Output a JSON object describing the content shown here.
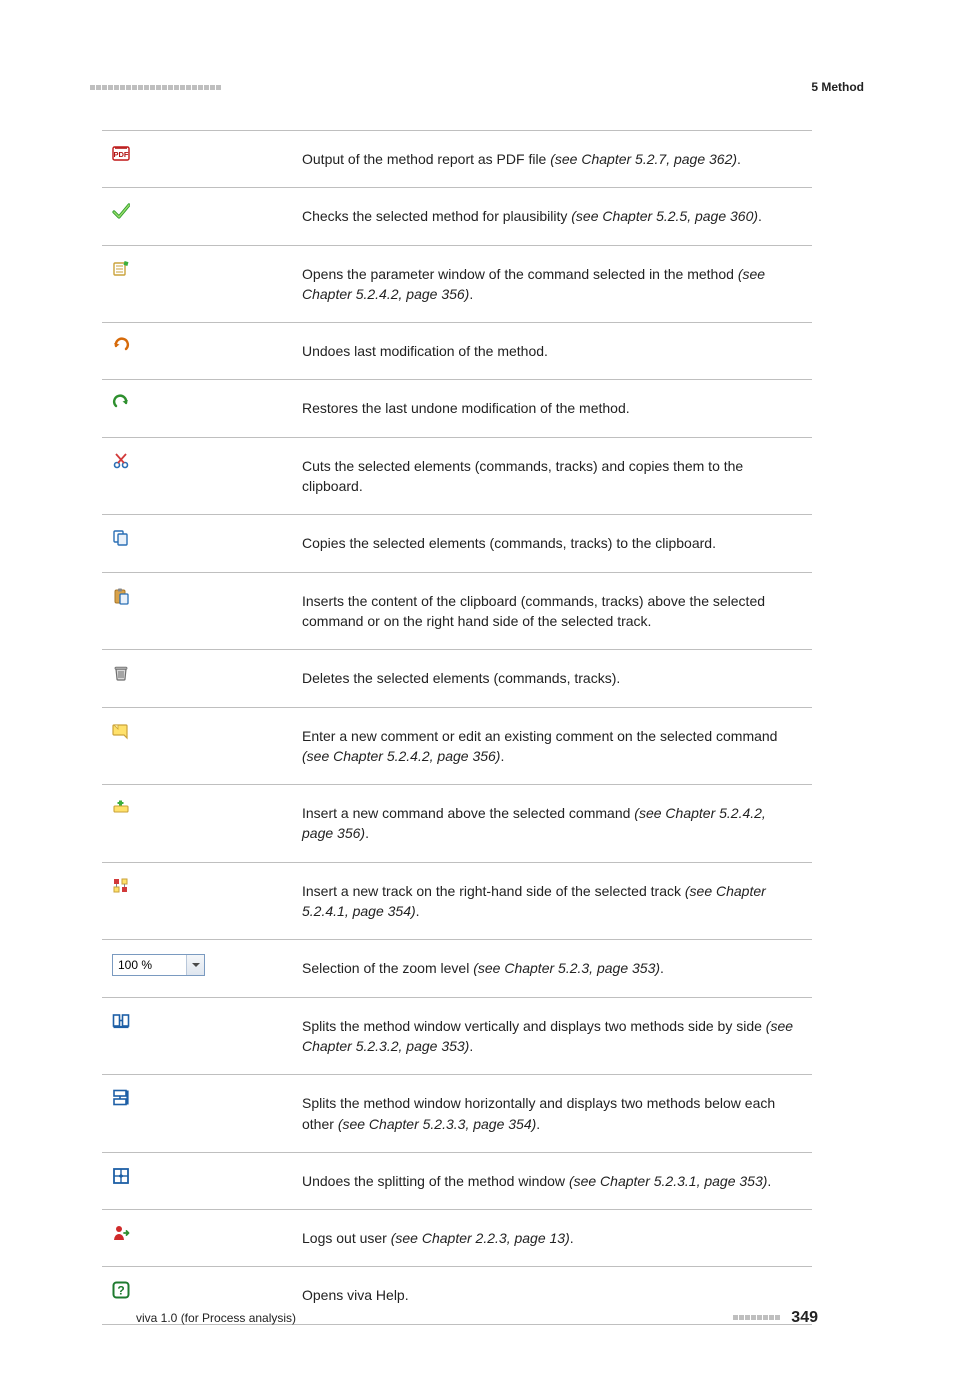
{
  "header": {
    "chapter": "5 Method"
  },
  "rows": [
    {
      "icon": "pdf",
      "desc": "Output of the method report as PDF file ",
      "ital": "(see Chapter 5.2.7, page 362)",
      "tail": "."
    },
    {
      "icon": "check",
      "desc": "Checks the selected method for plausibility ",
      "ital": "(see Chapter 5.2.5, page 360)",
      "tail": "."
    },
    {
      "icon": "properties",
      "desc": "Opens the parameter window of the command selected in the method ",
      "ital": "(see Chapter 5.2.4.2, page 356)",
      "tail": "."
    },
    {
      "icon": "undo",
      "desc": "Undoes last modification of the method.",
      "ital": "",
      "tail": ""
    },
    {
      "icon": "redo",
      "desc": "Restores the last undone modification of the method.",
      "ital": "",
      "tail": ""
    },
    {
      "icon": "cut",
      "desc": "Cuts the selected elements (commands, tracks) and copies them to the clipboard.",
      "ital": "",
      "tail": ""
    },
    {
      "icon": "copy",
      "desc": "Copies the selected elements (commands, tracks) to the clipboard.",
      "ital": "",
      "tail": ""
    },
    {
      "icon": "paste",
      "desc": "Inserts the content of the clipboard (commands, tracks) above the selected command or on the right hand side of the selected track.",
      "ital": "",
      "tail": ""
    },
    {
      "icon": "delete",
      "desc": "Deletes the selected elements (commands, tracks).",
      "ital": "",
      "tail": ""
    },
    {
      "icon": "comment",
      "desc": "Enter a new comment or edit an existing comment on the selected command ",
      "ital": "(see Chapter 5.2.4.2, page 356)",
      "tail": "."
    },
    {
      "icon": "insert-cmd",
      "desc": "Insert a new command above the selected command ",
      "ital": "(see Chapter 5.2.4.2, page 356)",
      "tail": "."
    },
    {
      "icon": "insert-track",
      "desc": "Insert a new track on the right-hand side of the selected track ",
      "ital": "(see Chapter 5.2.4.1, page 354)",
      "tail": "."
    },
    {
      "icon": "zoom",
      "desc": "Selection of the zoom level ",
      "ital": "(see Chapter 5.2.3, page 353)",
      "tail": "."
    },
    {
      "icon": "split-v",
      "desc": "Splits the method window vertically and displays two methods side by side ",
      "ital": "(see Chapter 5.2.3.2, page 353)",
      "tail": "."
    },
    {
      "icon": "split-h",
      "desc": "Splits the method window horizontally and displays two methods below each other ",
      "ital": "(see Chapter 5.2.3.3, page 354)",
      "tail": "."
    },
    {
      "icon": "unsplit",
      "desc": "Undoes the splitting of the method window ",
      "ital": "(see Chapter 5.2.3.1, page 353)",
      "tail": "."
    },
    {
      "icon": "logout",
      "desc": "Logs out user ",
      "ital": "(see Chapter 2.2.3, page 13)",
      "tail": "."
    },
    {
      "icon": "help",
      "desc": "Opens viva Help.",
      "ital": "",
      "tail": ""
    }
  ],
  "zoom": {
    "value": "100 %"
  },
  "footer": {
    "product": "viva 1.0 (for Process analysis)",
    "page": "349"
  }
}
